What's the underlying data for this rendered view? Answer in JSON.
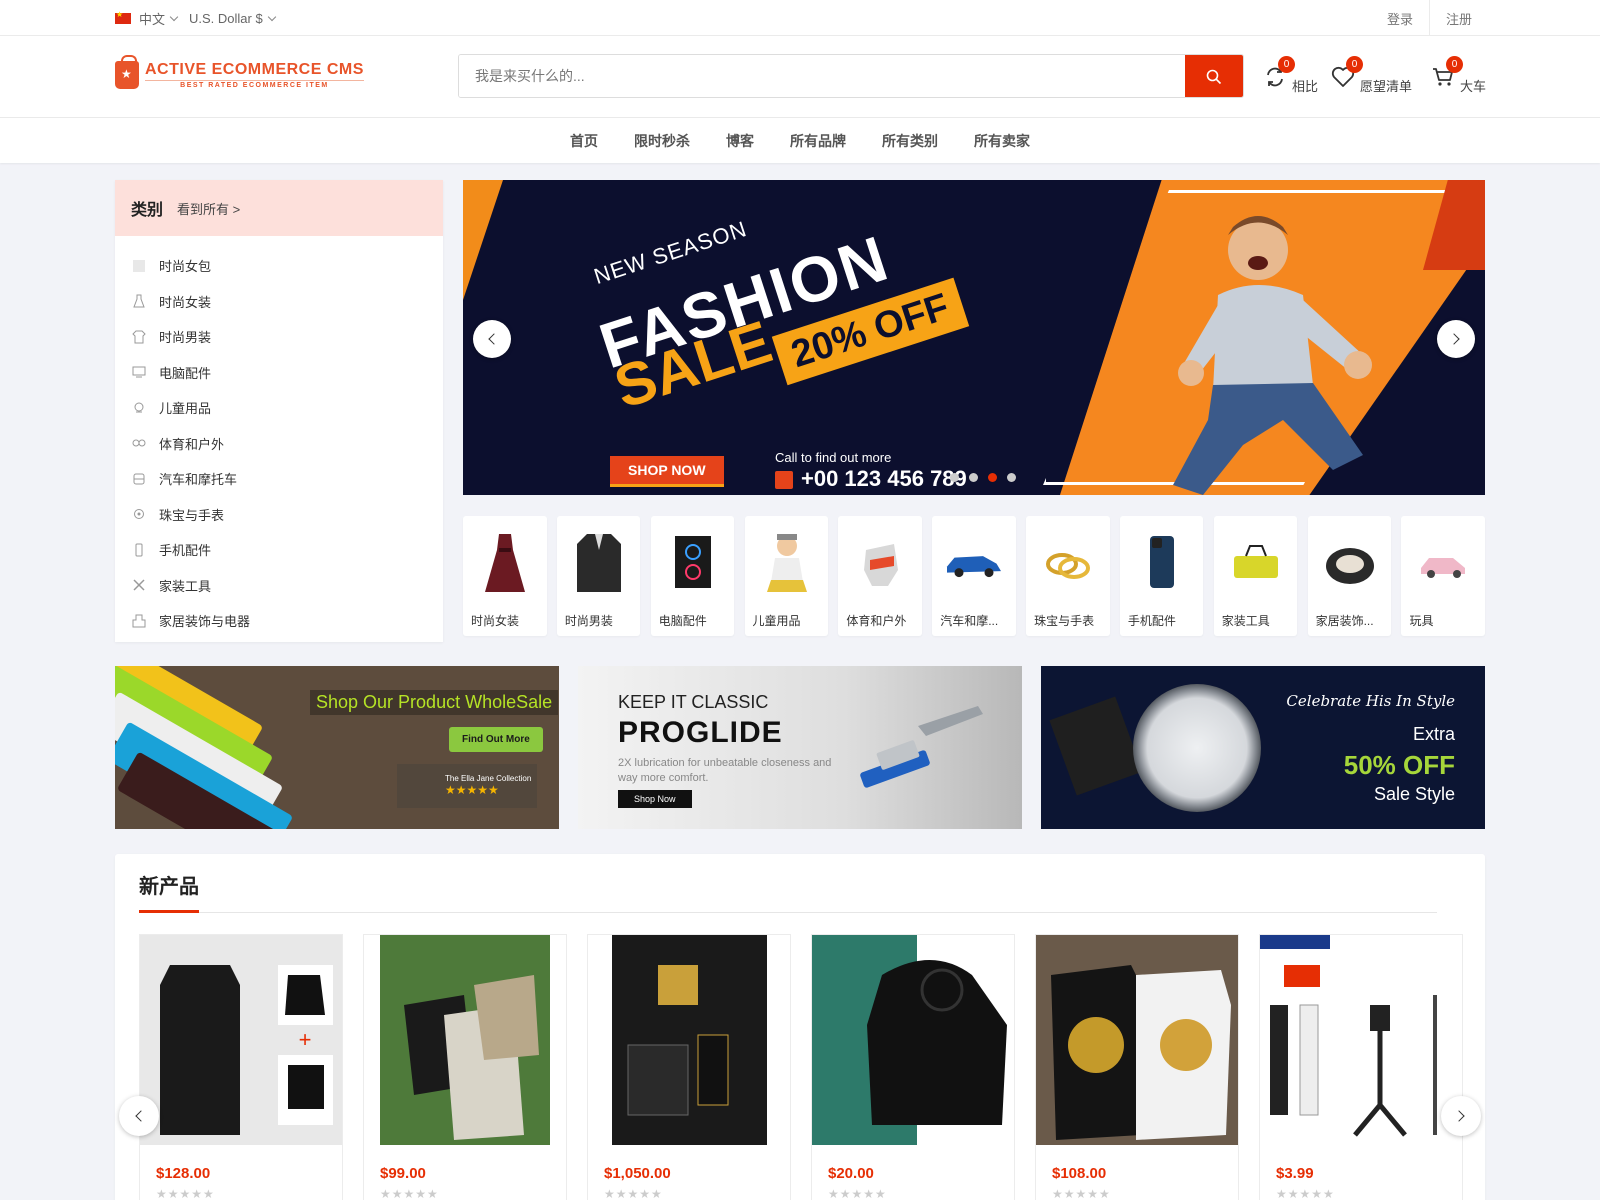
{
  "topbar": {
    "language": "中文",
    "currency": "U.S. Dollar $",
    "login": "登录",
    "register": "注册"
  },
  "header": {
    "logo_main": "ACTIVE ECOMMERCE CMS",
    "logo_sub": "BEST RATED ECOMMERCE ITEM",
    "search_placeholder": "我是来买什么的...",
    "compare": {
      "label": "相比",
      "count": "0"
    },
    "wishlist": {
      "label": "愿望清单",
      "count": "0"
    },
    "cart": {
      "label": "大车",
      "count": "0"
    },
    "accent_color": "#e62e04"
  },
  "nav": [
    "首页",
    "限时秒杀",
    "博客",
    "所有品牌",
    "所有类别",
    "所有卖家"
  ],
  "categories": {
    "title": "类别",
    "see_all": "看到所有 >",
    "items": [
      {
        "label": "时尚女包",
        "icon": "handbag-icon"
      },
      {
        "label": "时尚女装",
        "icon": "dress-icon"
      },
      {
        "label": "时尚男装",
        "icon": "shirt-icon"
      },
      {
        "label": "电脑配件",
        "icon": "computer-icon"
      },
      {
        "label": "儿童用品",
        "icon": "baby-icon"
      },
      {
        "label": "体育和户外",
        "icon": "sports-icon"
      },
      {
        "label": "汽车和摩托车",
        "icon": "car-icon"
      },
      {
        "label": "珠宝与手表",
        "icon": "watch-icon"
      },
      {
        "label": "手机配件",
        "icon": "phone-icon"
      },
      {
        "label": "家装工具",
        "icon": "tools-icon"
      },
      {
        "label": "家居装饰与电器",
        "icon": "home-icon"
      }
    ]
  },
  "slider": {
    "line1": "NEW SEASON",
    "line2": "FASHION",
    "line3": "SALE",
    "discount": "20% OFF",
    "button": "SHOP NOW",
    "call_text": "Call to find out more",
    "phone": "+00 123 456 789",
    "active_dot": 3,
    "dot_count": 4
  },
  "tiles": [
    {
      "label": "时尚女装",
      "icon": "dress-icon"
    },
    {
      "label": "时尚男装",
      "icon": "suit-icon"
    },
    {
      "label": "电脑配件",
      "icon": "pc-case-icon"
    },
    {
      "label": "儿童用品",
      "icon": "baby-icon"
    },
    {
      "label": "体育和户外",
      "icon": "glove-icon"
    },
    {
      "label": "汽车和摩...",
      "icon": "car-icon"
    },
    {
      "label": "珠宝与手表",
      "icon": "rings-icon"
    },
    {
      "label": "手机配件",
      "icon": "phone-icon"
    },
    {
      "label": "家装工具",
      "icon": "toolbag-icon"
    },
    {
      "label": "家居装饰...",
      "icon": "chair-icon"
    },
    {
      "label": "玩具",
      "icon": "toy-car-icon"
    }
  ],
  "banners": {
    "b1": {
      "title": "Shop Our Product WholeSale",
      "button": "Find Out More",
      "brand": "The Ella Jane Collection",
      "stars": "★★★★★"
    },
    "b2": {
      "kicker": "KEEP IT CLASSIC",
      "title": "PROGLIDE",
      "desc": "2X lubrication for unbeatable closeness and way more comfort.",
      "button": "Shop Now"
    },
    "b3": {
      "line1": "Celebrate His In Style",
      "line2": "Extra",
      "line3": "50% OFF",
      "line4": "Sale Style"
    }
  },
  "new_products": {
    "title": "新产品",
    "items": [
      {
        "price": "$128.00",
        "rating": "★★★★★"
      },
      {
        "price": "$99.00",
        "rating": "★★★★★"
      },
      {
        "price": "$1,050.00",
        "rating": "★★★★★"
      },
      {
        "price": "$20.00",
        "rating": "★★★★★"
      },
      {
        "price": "$108.00",
        "rating": "★★★★★"
      },
      {
        "price": "$3.99",
        "rating": "★★★★★"
      }
    ]
  }
}
